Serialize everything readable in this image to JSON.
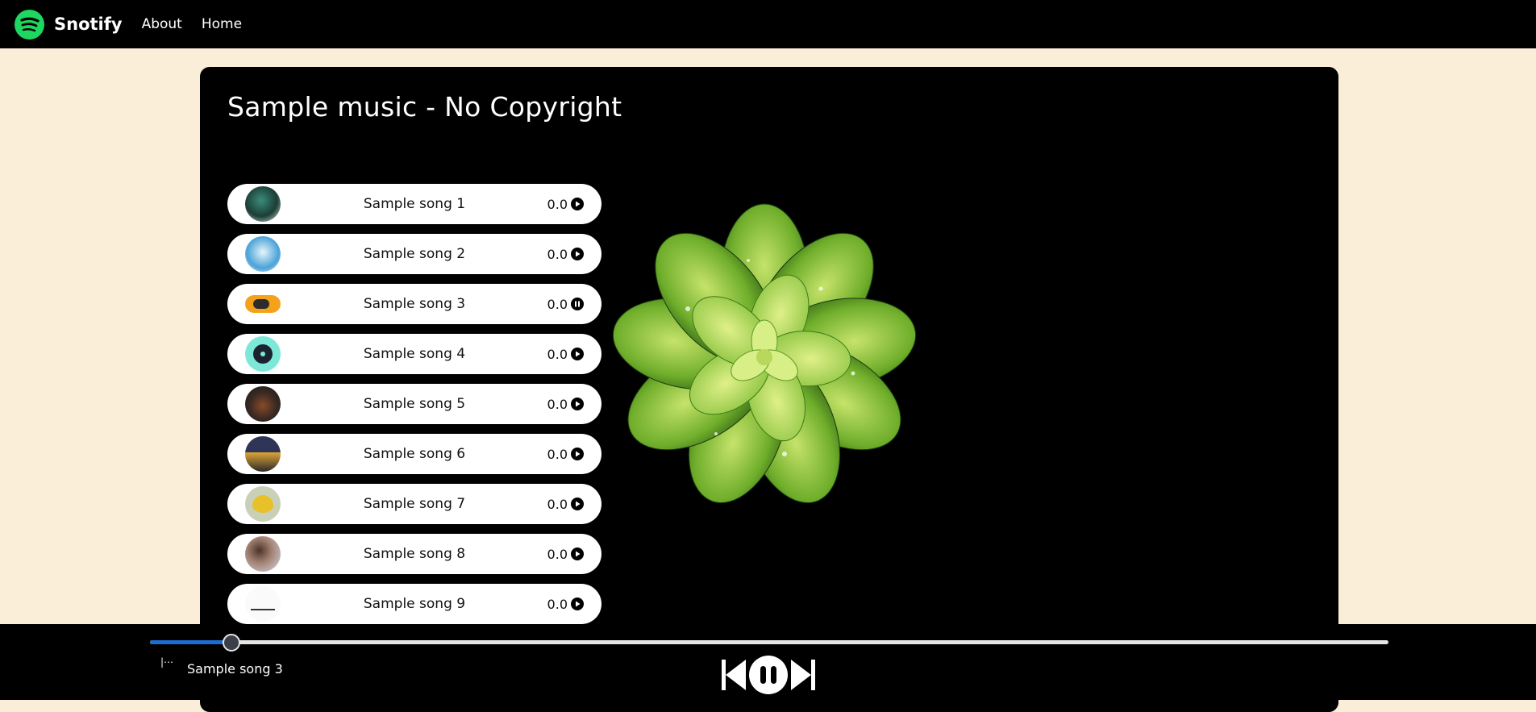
{
  "navbar": {
    "brand": "Snotify",
    "links": [
      "About",
      "Home"
    ]
  },
  "main": {
    "title": "Sample music - No Copyright",
    "songs": [
      {
        "name": "Sample song 1",
        "time": "0.0",
        "state": "play"
      },
      {
        "name": "Sample song 2",
        "time": "0.0",
        "state": "play"
      },
      {
        "name": "Sample song 3",
        "time": "0.0",
        "state": "pause"
      },
      {
        "name": "Sample song 4",
        "time": "0.0",
        "state": "play"
      },
      {
        "name": "Sample song 5",
        "time": "0.0",
        "state": "play"
      },
      {
        "name": "Sample song 6",
        "time": "0.0",
        "state": "play"
      },
      {
        "name": "Sample song 7",
        "time": "0.0",
        "state": "play"
      },
      {
        "name": "Sample song 8",
        "time": "0.0",
        "state": "play"
      },
      {
        "name": "Sample song 9",
        "time": "0.0",
        "state": "play"
      }
    ]
  },
  "player": {
    "now_playing": "Sample song 3",
    "progress": 0.066
  },
  "colors": {
    "background": "#fbeed9",
    "accent": "#1ed760",
    "progress": "#1c6dd0"
  }
}
